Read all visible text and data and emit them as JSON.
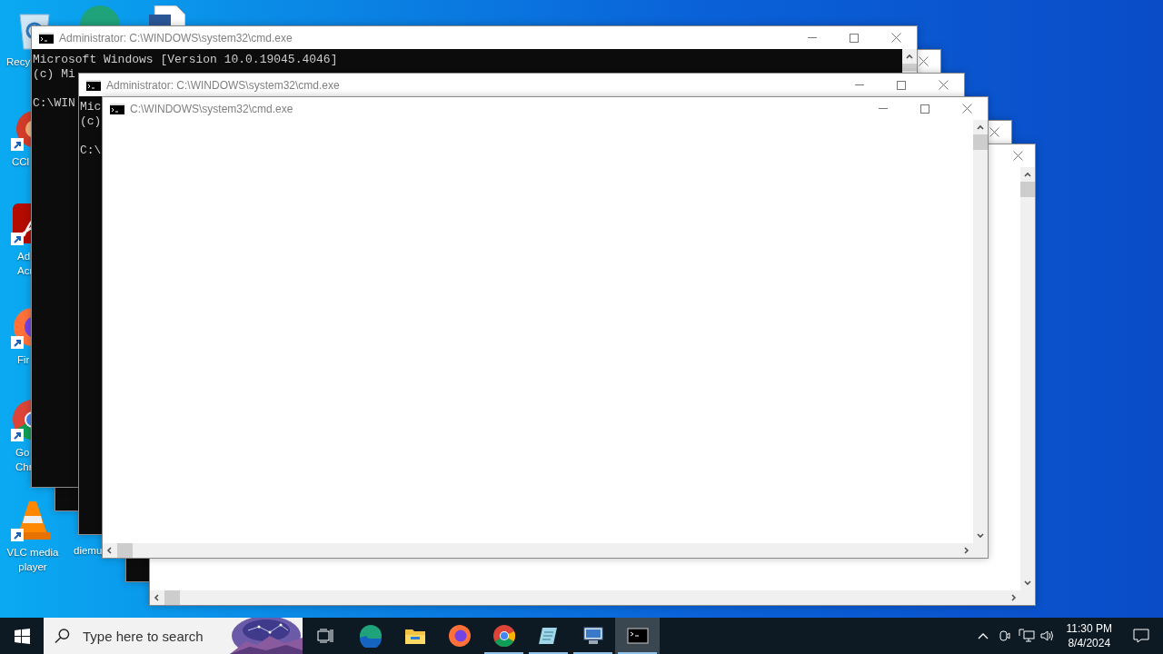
{
  "desktop": {
    "icons": [
      {
        "kind": "recycle-bin",
        "label_lines": [
          "Recy"
        ]
      },
      {
        "kind": "edge"
      },
      {
        "kind": "document"
      },
      {
        "kind": "ccleaner",
        "label_lines": [
          "CCl"
        ]
      },
      {
        "kind": "acrobat",
        "label_lines": [
          "Ad",
          "Acr"
        ]
      },
      {
        "kind": "firefox",
        "label_lines": [
          "Fir"
        ]
      },
      {
        "kind": "chrome",
        "label_lines": [
          "Go",
          "Chr"
        ]
      },
      {
        "kind": "vlc",
        "label_lines": [
          "VLC media",
          "player"
        ]
      },
      {
        "label_lines": [
          "diemu"
        ]
      }
    ]
  },
  "windows": [
    {
      "kind": "console",
      "title": "Administrator: C:\\WINDOWS\\system32\\cmd.exe",
      "paragraphs": [
        [
          "Microsoft Windows [Version 10.0.19045.4046]",
          "(c) Mi"
        ],
        [
          "C:\\WIN"
        ]
      ]
    },
    {
      "kind": "console"
    },
    {
      "kind": "console",
      "title": "Administrator: C:\\WINDOWS\\system32\\cmd.exe",
      "paragraphs": [
        [
          "Mic",
          "(c)"
        ],
        [
          "C:\\"
        ]
      ]
    },
    {
      "kind": "blank",
      "title": "C:\\WINDOWS\\system32\\cmd.exe"
    },
    {
      "kind": "console"
    },
    {
      "kind": "blank"
    }
  ],
  "taskbar": {
    "search": {
      "placeholder": "Type here to search"
    },
    "apps": [
      {
        "kind": "edge",
        "running": false,
        "selected": false
      },
      {
        "kind": "explorer",
        "running": false,
        "selected": false
      },
      {
        "kind": "firefox",
        "running": false,
        "selected": false
      },
      {
        "kind": "chrome",
        "running": true,
        "selected": false
      },
      {
        "kind": "notepad",
        "running": true,
        "selected": false
      },
      {
        "kind": "network",
        "running": true,
        "selected": false
      },
      {
        "kind": "terminal",
        "running": true,
        "selected": true
      }
    ],
    "clock": {
      "time": "11:30 PM",
      "date": "8/4/2024"
    }
  }
}
